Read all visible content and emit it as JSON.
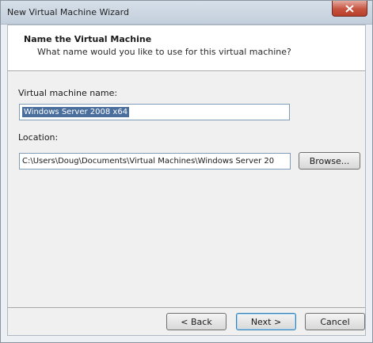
{
  "window": {
    "title": "New Virtual Machine Wizard",
    "close_icon": "close-icon"
  },
  "header": {
    "title": "Name the Virtual Machine",
    "subtitle": "What name would you like to use for this virtual machine?"
  },
  "form": {
    "vm_name_label": "Virtual machine name:",
    "vm_name_value": "Windows Server 2008 x64",
    "location_label": "Location:",
    "location_value": "C:\\Users\\Doug\\Documents\\Virtual Machines\\Windows Server 20",
    "browse_label": "Browse..."
  },
  "footer": {
    "back_label": "< Back",
    "next_label": "Next >",
    "cancel_label": "Cancel"
  },
  "colors": {
    "selection": "#4a6f9d",
    "close_button": "#c6533f",
    "titlebar": "#c3cfdc"
  }
}
